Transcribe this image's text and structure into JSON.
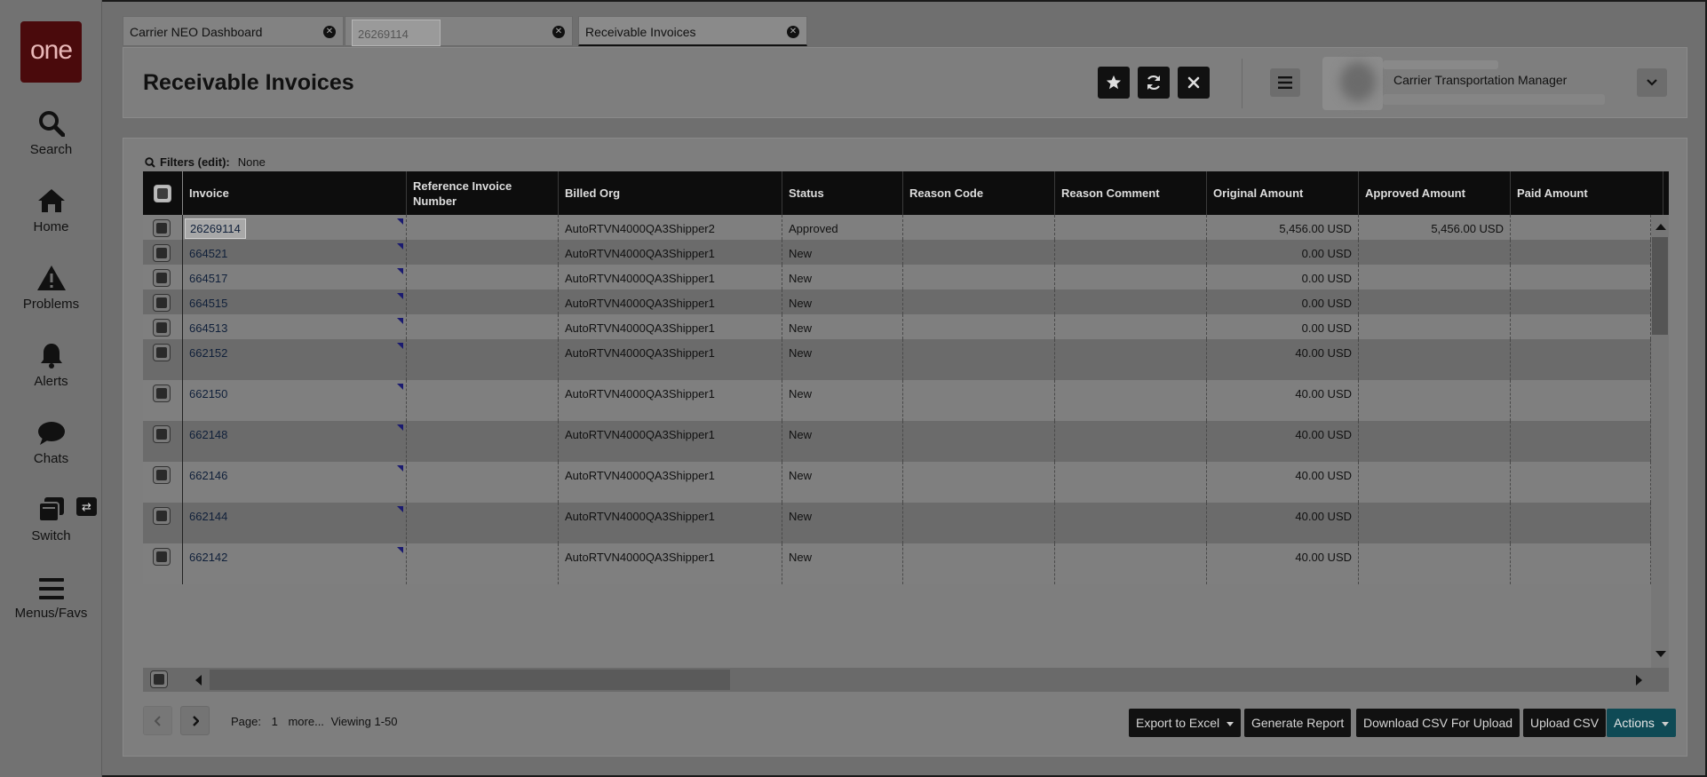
{
  "sidebar": {
    "logo": "one",
    "items": [
      {
        "label": "Search",
        "icon": "search-icon"
      },
      {
        "label": "Home",
        "icon": "home-icon"
      },
      {
        "label": "Problems",
        "icon": "warning-icon"
      },
      {
        "label": "Alerts",
        "icon": "bell-icon"
      },
      {
        "label": "Chats",
        "icon": "chat-icon"
      },
      {
        "label": "Switch",
        "icon": "switch-icon"
      },
      {
        "label": "Menus/Favs",
        "icon": "menu-icon"
      }
    ],
    "switch_badge": "⇄"
  },
  "tabs": [
    {
      "label": "Carrier NEO Dashboard"
    },
    {
      "label": "26269114"
    },
    {
      "label": "Receivable Invoices"
    }
  ],
  "header": {
    "title": "Receivable Invoices",
    "role": "Carrier Transportation Manager"
  },
  "filters": {
    "label": "Filters (edit):",
    "value": "None"
  },
  "table": {
    "columns": [
      "Invoice",
      "Reference Invoice Number",
      "Billed Org",
      "Status",
      "Reason Code",
      "Reason Comment",
      "Original Amount",
      "Approved Amount",
      "Paid Amount"
    ],
    "rows": [
      {
        "invoice": "26269114",
        "ref": "",
        "billed_org": "AutoRTVN4000QA3Shipper2",
        "status": "Approved",
        "reason_code": "",
        "reason_comment": "",
        "original": "5,456.00 USD",
        "approved": "5,456.00 USD",
        "paid": ""
      },
      {
        "invoice": "664521",
        "ref": "",
        "billed_org": "AutoRTVN4000QA3Shipper1",
        "status": "New",
        "reason_code": "",
        "reason_comment": "",
        "original": "0.00 USD",
        "approved": "",
        "paid": ""
      },
      {
        "invoice": "664517",
        "ref": "",
        "billed_org": "AutoRTVN4000QA3Shipper1",
        "status": "New",
        "reason_code": "",
        "reason_comment": "",
        "original": "0.00 USD",
        "approved": "",
        "paid": ""
      },
      {
        "invoice": "664515",
        "ref": "",
        "billed_org": "AutoRTVN4000QA3Shipper1",
        "status": "New",
        "reason_code": "",
        "reason_comment": "",
        "original": "0.00 USD",
        "approved": "",
        "paid": ""
      },
      {
        "invoice": "664513",
        "ref": "",
        "billed_org": "AutoRTVN4000QA3Shipper1",
        "status": "New",
        "reason_code": "",
        "reason_comment": "",
        "original": "0.00 USD",
        "approved": "",
        "paid": ""
      },
      {
        "invoice": "662152",
        "ref": "",
        "billed_org": "AutoRTVN4000QA3Shipper1",
        "status": "New",
        "reason_code": "",
        "reason_comment": "",
        "original": "40.00 USD",
        "approved": "",
        "paid": ""
      },
      {
        "invoice": "662150",
        "ref": "",
        "billed_org": "AutoRTVN4000QA3Shipper1",
        "status": "New",
        "reason_code": "",
        "reason_comment": "",
        "original": "40.00 USD",
        "approved": "",
        "paid": ""
      },
      {
        "invoice": "662148",
        "ref": "",
        "billed_org": "AutoRTVN4000QA3Shipper1",
        "status": "New",
        "reason_code": "",
        "reason_comment": "",
        "original": "40.00 USD",
        "approved": "",
        "paid": ""
      },
      {
        "invoice": "662146",
        "ref": "",
        "billed_org": "AutoRTVN4000QA3Shipper1",
        "status": "New",
        "reason_code": "",
        "reason_comment": "",
        "original": "40.00 USD",
        "approved": "",
        "paid": ""
      },
      {
        "invoice": "662144",
        "ref": "",
        "billed_org": "AutoRTVN4000QA3Shipper1",
        "status": "New",
        "reason_code": "",
        "reason_comment": "",
        "original": "40.00 USD",
        "approved": "",
        "paid": ""
      },
      {
        "invoice": "662142",
        "ref": "",
        "billed_org": "AutoRTVN4000QA3Shipper1",
        "status": "New",
        "reason_code": "",
        "reason_comment": "",
        "original": "40.00 USD",
        "approved": "",
        "paid": ""
      }
    ]
  },
  "pager": {
    "page_label": "Page:",
    "page_number": "1",
    "more": "more...",
    "viewing": "Viewing 1-50"
  },
  "footer_buttons": {
    "export": "Export to Excel",
    "report": "Generate Report",
    "download_csv": "Download CSV For Upload",
    "upload_csv": "Upload CSV",
    "actions": "Actions"
  }
}
